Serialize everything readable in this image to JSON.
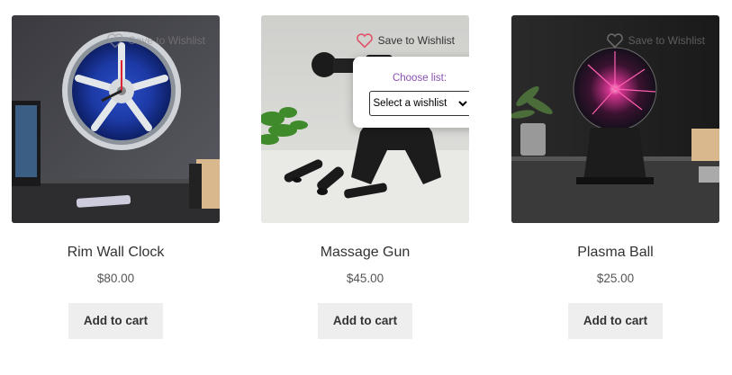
{
  "products": [
    {
      "title": "Rim Wall Clock",
      "price": "$80.00",
      "cart_label": "Add to cart",
      "wishlist_label": "Save to Wishlist"
    },
    {
      "title": "Massage Gun",
      "price": "$45.00",
      "cart_label": "Add to cart",
      "wishlist_label": "Save to Wishlist",
      "wishlist_popup": {
        "label": "Choose list:",
        "select_value": "Select a wishlist"
      }
    },
    {
      "title": "Plasma Ball",
      "price": "$25.00",
      "cart_label": "Add to cart",
      "wishlist_label": "Save to Wishlist"
    }
  ],
  "colors": {
    "wishlist_heart_active": "#e0556a",
    "popup_label": "#8a4fb2",
    "cart_button_bg": "#eeeeee"
  }
}
